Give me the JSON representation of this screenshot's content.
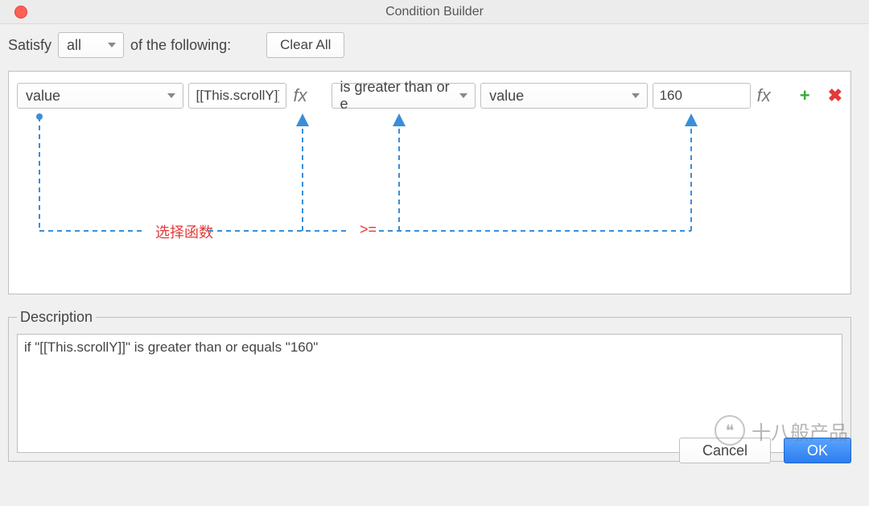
{
  "window": {
    "title": "Condition Builder"
  },
  "top": {
    "satisfy_label": "Satisfy",
    "satisfy_value": "all",
    "following_label": "of the following:",
    "clear_all": "Clear All"
  },
  "condition": {
    "left_type": "value",
    "left_expr": "[[This.scrollY]]",
    "fx1": "fx",
    "operator": "is greater than or e",
    "right_type": "value",
    "right_value": "160",
    "fx2": "fx"
  },
  "annotation": {
    "select_function": "选择函数",
    "gte": ">="
  },
  "description": {
    "legend": "Description",
    "text": "if \"[[This.scrollY]]\" is greater than or equals \"160\""
  },
  "footer": {
    "cancel": "Cancel",
    "ok": "OK"
  },
  "watermark": {
    "text": "十八般产品"
  }
}
